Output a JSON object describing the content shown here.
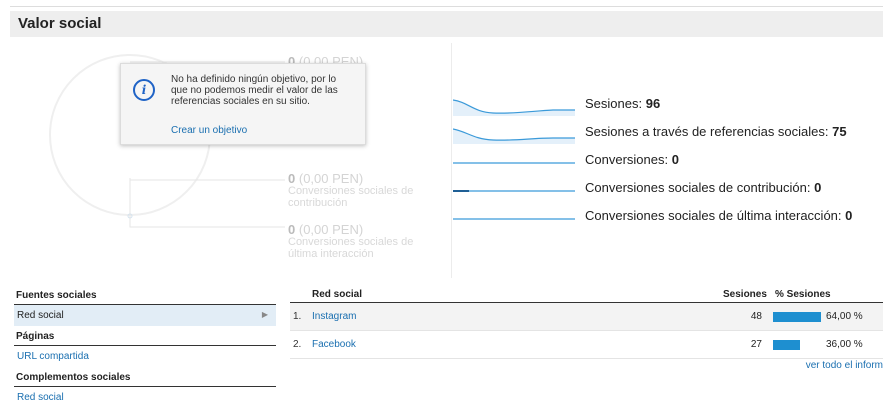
{
  "title": "Valor social",
  "funnel": {
    "top": {
      "value": "0",
      "currency": "(0,00 PEN)"
    },
    "assisted": {
      "value": "0",
      "currency": "(0,00 PEN)",
      "label": "Conversiones sociales de contribución"
    },
    "last": {
      "value": "0",
      "currency": "(0,00 PEN)",
      "label": "Conversiones sociales de última interacción"
    }
  },
  "tooltip": {
    "message": "No ha definido ningún objetivo, por lo que no podemos medir el valor de las referencias sociales en su sitio.",
    "link": "Crear un objetivo"
  },
  "metrics": [
    {
      "label": "Sesiones:",
      "value": "96"
    },
    {
      "label": "Sesiones a través de referencias sociales:",
      "value": "75"
    },
    {
      "label": "Conversiones:",
      "value": "0"
    },
    {
      "label": "Conversiones sociales de contribución:",
      "value": "0"
    },
    {
      "label": "Conversiones sociales de última interacción:",
      "value": "0"
    }
  ],
  "nav": {
    "sections": [
      {
        "title": "Fuentes sociales",
        "items": [
          "Red social"
        ]
      },
      {
        "title": "Páginas",
        "items": [
          "URL compartida"
        ]
      },
      {
        "title": "Complementos sociales",
        "items": [
          "Red social"
        ]
      }
    ]
  },
  "table": {
    "headers": [
      "Red social",
      "Sesiones",
      "% Sesiones"
    ],
    "rows": [
      {
        "num": "1.",
        "name": "Instagram",
        "sessions": "48",
        "pct": "64,00 %",
        "pct_value": 64.0
      },
      {
        "num": "2.",
        "name": "Facebook",
        "sessions": "27",
        "pct": "36,00 %",
        "pct_value": 36.0
      }
    ],
    "more": "ver todo el inform"
  },
  "colors": {
    "accent": "#1e8fd0",
    "link": "#1a6fb0"
  }
}
